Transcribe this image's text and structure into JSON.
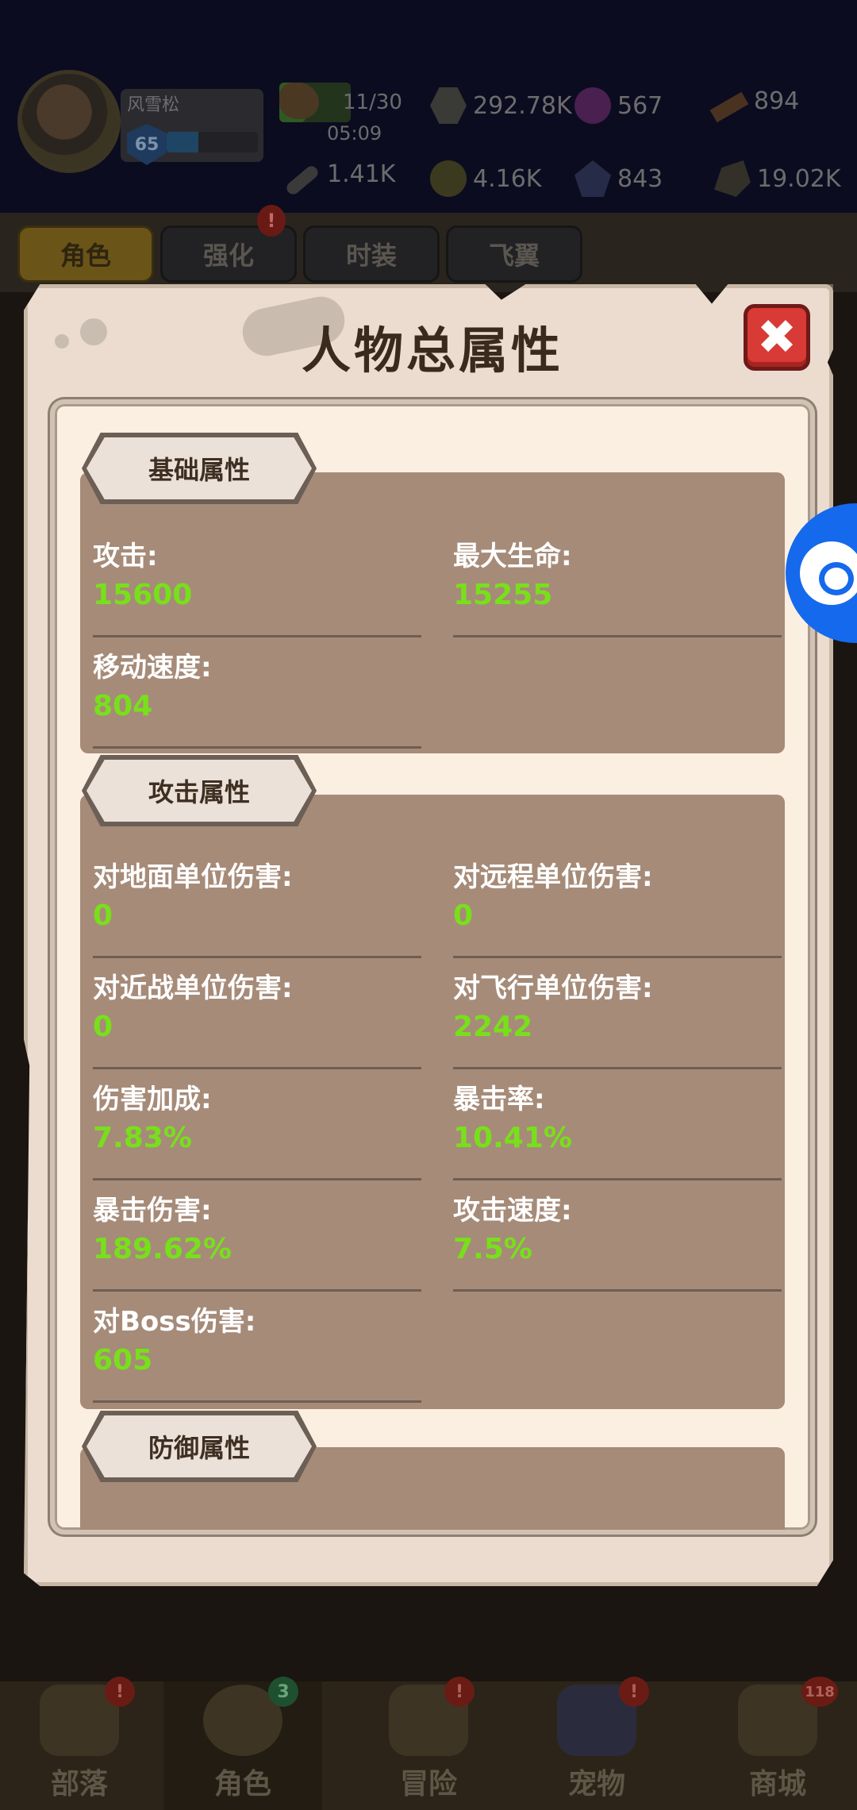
{
  "player": {
    "name": "风雪松",
    "level": "65",
    "xp_fraction": 0.35
  },
  "resources": {
    "stamina": "11/30",
    "stamina_fraction": 0.37,
    "stamina_timer": "05:09",
    "gold": "292.78K",
    "gem": "567",
    "wood": "894",
    "bone": "1.41K",
    "coin": "4.16K",
    "crystal": "843",
    "ore": "19.02K"
  },
  "tabs": [
    {
      "label": "角色"
    },
    {
      "label": "强化"
    },
    {
      "label": "时装"
    },
    {
      "label": "飞翼"
    }
  ],
  "tab_badge": "!",
  "modal": {
    "title": "人物总属性",
    "close_glyph": "✖",
    "sections": {
      "basic": {
        "title": "基础属性",
        "stats": [
          {
            "label": "攻击:",
            "value": "15600"
          },
          {
            "label": "最大生命:",
            "value": "15255"
          },
          {
            "label": "移动速度:",
            "value": "804"
          }
        ]
      },
      "attack": {
        "title": "攻击属性",
        "stats": [
          {
            "label": "对地面单位伤害:",
            "value": "0"
          },
          {
            "label": "对远程单位伤害:",
            "value": "0"
          },
          {
            "label": "对近战单位伤害:",
            "value": "0"
          },
          {
            "label": "对飞行单位伤害:",
            "value": "2242"
          },
          {
            "label": "伤害加成:",
            "value": "7.83%"
          },
          {
            "label": "暴击率:",
            "value": "10.41%"
          },
          {
            "label": "暴击伤害:",
            "value": "189.62%"
          },
          {
            "label": "攻击速度:",
            "value": "7.5%"
          },
          {
            "label": "对Boss伤害:",
            "value": "605"
          }
        ]
      },
      "defense": {
        "title": "防御属性"
      }
    }
  },
  "bottom_nav": [
    {
      "label": "部落",
      "badge": "!"
    },
    {
      "label": "角色",
      "badge": "3"
    },
    {
      "label": "冒险",
      "badge": "!"
    },
    {
      "label": "宠物",
      "badge": "!"
    },
    {
      "label": "商城",
      "badge": "118"
    }
  ],
  "colors": {
    "stat_value": "#78e01a",
    "modal_bg": "#ebdccf",
    "section_bg": "#a68b79",
    "close_button": "#d83a36",
    "float_button": "#1569ec"
  }
}
